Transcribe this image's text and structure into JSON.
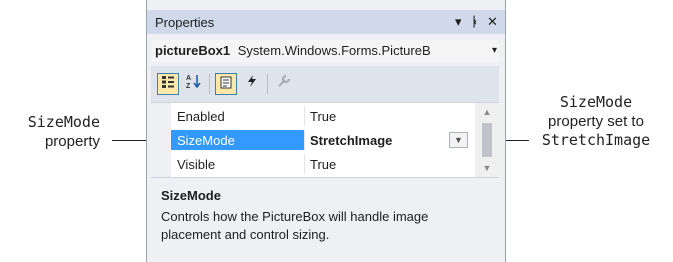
{
  "callouts": {
    "left": {
      "property_name": "SizeMode",
      "text": "property"
    },
    "right": {
      "property_name": "SizeMode",
      "text": "property set to",
      "value": "StretchImage"
    }
  },
  "panel": {
    "title": "Properties",
    "controls": {
      "dropdown": "▾",
      "pin": "ᵖ",
      "close": "✕"
    },
    "object_selector": {
      "name": "pictureBox1",
      "type": "System.Windows.Forms.PictureB",
      "arrow": "▾"
    },
    "toolbar": [
      {
        "name": "categorized-button",
        "glyph": "▤",
        "active": true
      },
      {
        "name": "alphabetical-button",
        "glyph": "A↓",
        "active": false
      },
      {
        "name": "properties-button",
        "glyph": "🗒",
        "active": true
      },
      {
        "name": "events-button",
        "glyph": "ϟ",
        "active": false
      },
      {
        "name": "property-pages-button",
        "glyph": "🔧",
        "active": false,
        "disabled": true
      }
    ],
    "rows": [
      {
        "name": "Enabled",
        "value": "True",
        "selected": false
      },
      {
        "name": "SizeMode",
        "value": "StretchImage",
        "selected": true
      },
      {
        "name": "Visible",
        "value": "True",
        "selected": false
      }
    ],
    "description": {
      "title": "SizeMode",
      "text": "Controls how the PictureBox will handle image placement and control sizing."
    }
  }
}
